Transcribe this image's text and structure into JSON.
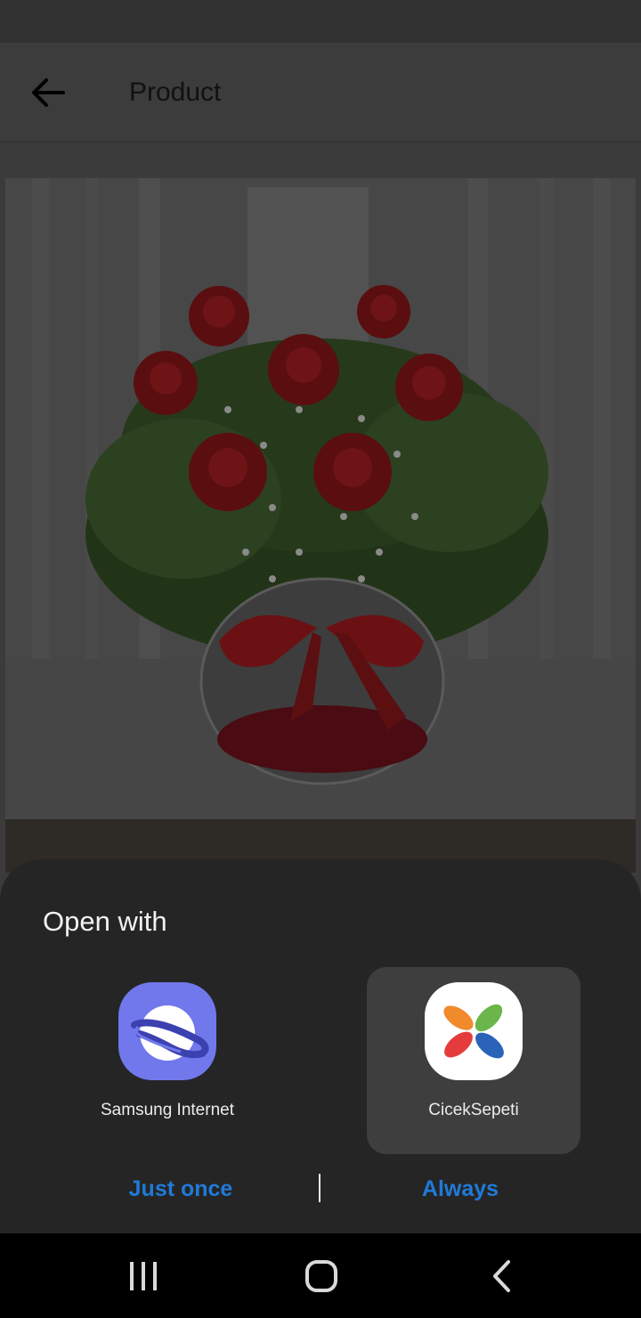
{
  "app_bar": {
    "back_icon": "arrow-left-icon",
    "title": "Product"
  },
  "product": {
    "image_subject": "red-roses-bouquet-in-glass-vase"
  },
  "chooser": {
    "title": "Open with",
    "apps": [
      {
        "label": "Samsung Internet",
        "icon": "samsung-internet-icon",
        "selected": false
      },
      {
        "label": "CicekSepeti",
        "icon": "ciceksepeti-icon",
        "selected": true
      }
    ],
    "just_once_label": "Just once",
    "always_label": "Always"
  },
  "nav": {
    "recents_icon": "recents-icon",
    "home_icon": "home-icon",
    "back_icon": "back-chevron-icon"
  },
  "colors": {
    "accent": "#1f7ad8",
    "sheet_background": "#252525",
    "selected_background": "#3e3e3e"
  }
}
